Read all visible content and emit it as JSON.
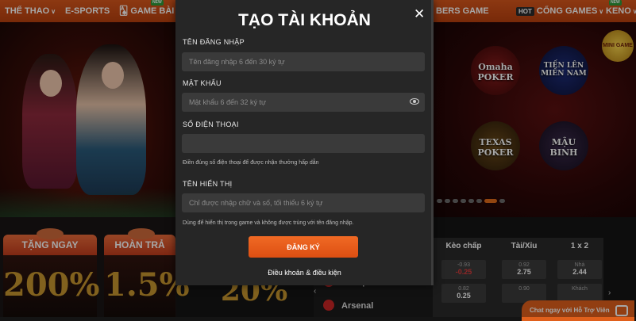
{
  "nav": {
    "items": [
      {
        "label": "THỂ THAO",
        "chevron": true
      },
      {
        "label": "E-SPORTS",
        "chevron": false
      },
      {
        "label": "GAME BÀI",
        "chevron": true,
        "tag": "NEW"
      },
      {
        "label": "BERS GAME",
        "chevron": false
      },
      {
        "label": "CỔNG GAMES",
        "chevron": true,
        "badge": "HOT"
      },
      {
        "label": "KENO",
        "chevron": true,
        "tag": "NEW"
      }
    ]
  },
  "hero": {
    "games": [
      "Omaha POKER",
      "TIẾN LÊN MIỀN NAM",
      "TEXAS POKER",
      "MẬU BINH"
    ],
    "mini_game_label": "MINI GAME"
  },
  "promos": [
    {
      "title": "TẶNG NGAY",
      "value": "200%"
    },
    {
      "title": "HOÀN TRẢ",
      "value": "1.5%"
    },
    {
      "title": "",
      "value": "20%"
    }
  ],
  "odds": {
    "headers": [
      "Kèo chấp",
      "Tài/Xỉu",
      "1 x 2"
    ],
    "row1": [
      {
        "top": "-0.93",
        "main": "-0.25",
        "negative": true
      },
      {
        "top": "0.92",
        "main": "2.75"
      },
      {
        "top": "Nhà",
        "main": "2.44"
      }
    ],
    "row2": [
      {
        "top": "0.82",
        "main": "0.25"
      },
      {
        "top": "0.90",
        "main": ""
      },
      {
        "top": "Khách",
        "main": ""
      }
    ],
    "teams": [
      "Liverpool",
      "Arsenal"
    ]
  },
  "chat": {
    "label": "Chat ngay với Hỗ Trợ Viên"
  },
  "modal": {
    "title": "TẠO TÀI KHOẢN",
    "close": "✕",
    "username": {
      "label": "TÊN ĐĂNG NHẬP",
      "placeholder": "Tên đăng nhập 6 đến 30 ký tự"
    },
    "password": {
      "label": "MẬT KHẨU",
      "placeholder": "Mật khẩu 6 đến 32 ký tự"
    },
    "phone": {
      "label": "SỐ ĐIỆN THOẠI",
      "placeholder": "",
      "hint": "Điền đúng số điện thoại để được nhận thưởng hấp dẫn"
    },
    "display_name": {
      "label": "TÊN HIỂN THỊ",
      "placeholder": "Chỉ được nhập chữ và số, tối thiểu 6 ký tự",
      "hint": "Dùng để hiển thị trong game và không được trùng với tên đăng nhập."
    },
    "submit": "ĐĂNG KÝ",
    "terms": "Điều khoản & điều kiện"
  }
}
